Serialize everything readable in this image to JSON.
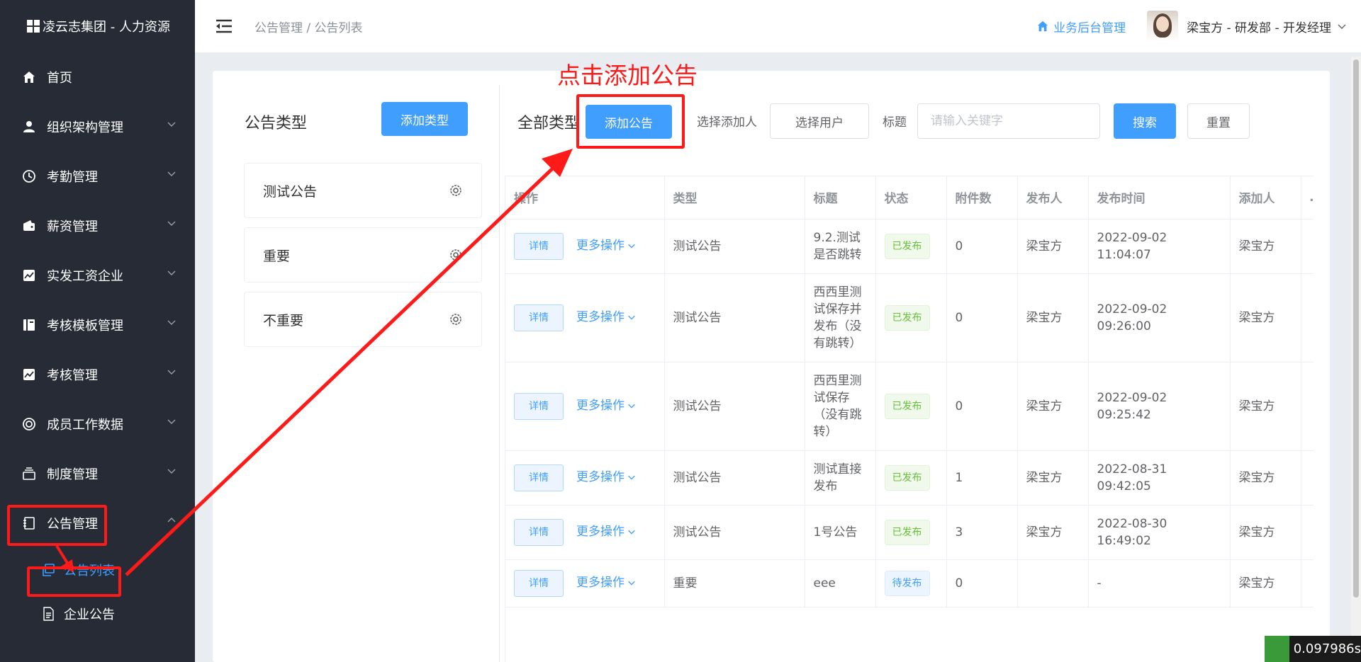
{
  "brand": {
    "title": "凌云志集团 - 人力资源"
  },
  "sidebar": {
    "items": [
      {
        "label": "首页",
        "icon": "home-icon"
      },
      {
        "label": "组织架构管理",
        "icon": "user-icon"
      },
      {
        "label": "考勤管理",
        "icon": "clock-icon"
      },
      {
        "label": "薪资管理",
        "icon": "wallet-icon"
      },
      {
        "label": "实发工资企业",
        "icon": "chart-icon"
      },
      {
        "label": "考核模板管理",
        "icon": "template-icon"
      },
      {
        "label": "考核管理",
        "icon": "chart-icon"
      },
      {
        "label": "成员工作数据",
        "icon": "lifebuoy-icon"
      },
      {
        "label": "制度管理",
        "icon": "stack-icon"
      },
      {
        "label": "公告管理",
        "icon": "notebook-icon"
      }
    ],
    "sub_items": [
      {
        "label": "公告列表",
        "icon": "copy-icon"
      },
      {
        "label": "企业公告",
        "icon": "document-icon"
      }
    ]
  },
  "header": {
    "breadcrumb": "公告管理 / 公告列表",
    "biz_link": "业务后台管理",
    "user": "梁宝方 - 研发部 - 开发经理"
  },
  "type_panel": {
    "title": "公告类型",
    "add_button": "添加类型",
    "types": [
      "测试公告",
      "重要",
      "不重要"
    ]
  },
  "toolbar": {
    "all_types": "全部类型",
    "add_notice": "添加公告",
    "adder_label": "选择添加人",
    "select_user": "选择用户",
    "title_label": "标题",
    "search_placeholder": "请输入关键字",
    "search": "搜索",
    "reset": "重置"
  },
  "table": {
    "headers": [
      "操作",
      "类型",
      "标题",
      "状态",
      "附件数",
      "发布人",
      "发布时间",
      "添加人",
      "…"
    ],
    "detail_label": "详情",
    "more_label": "更多操作",
    "rows": [
      {
        "type": "测试公告",
        "title": "9.2.测试是否跳转",
        "status": "已发布",
        "status_kind": "success",
        "attachments": "0",
        "publisher": "梁宝方",
        "time": "2022-09-02 11:04:07",
        "adder": "梁宝方"
      },
      {
        "type": "测试公告",
        "title": "西西里测试保存并发布（没有跳转）",
        "status": "已发布",
        "status_kind": "success",
        "attachments": "0",
        "publisher": "梁宝方",
        "time": "2022-09-02 09:26:00",
        "adder": "梁宝方"
      },
      {
        "type": "测试公告",
        "title": "西西里测试保存（没有跳转）",
        "status": "已发布",
        "status_kind": "success",
        "attachments": "0",
        "publisher": "梁宝方",
        "time": "2022-09-02 09:25:42",
        "adder": "梁宝方"
      },
      {
        "type": "测试公告",
        "title": "测试直接发布",
        "status": "已发布",
        "status_kind": "success",
        "attachments": "1",
        "publisher": "梁宝方",
        "time": "2022-08-31 09:42:05",
        "adder": "梁宝方"
      },
      {
        "type": "测试公告",
        "title": "1号公告",
        "status": "已发布",
        "status_kind": "success",
        "attachments": "3",
        "publisher": "梁宝方",
        "time": "2022-08-30 16:49:02",
        "adder": "梁宝方"
      },
      {
        "type": "重要",
        "title": "eee",
        "status": "待发布",
        "status_kind": "info",
        "attachments": "0",
        "publisher": "",
        "time": "-",
        "adder": "梁宝方"
      }
    ]
  },
  "annotation": {
    "text": "点击添加公告",
    "color": "#ff1a1a"
  },
  "timer": {
    "text": "0.097986s"
  },
  "colors": {
    "primary": "#409eff",
    "sidebar": "#262b35",
    "success": "#67c23a"
  }
}
